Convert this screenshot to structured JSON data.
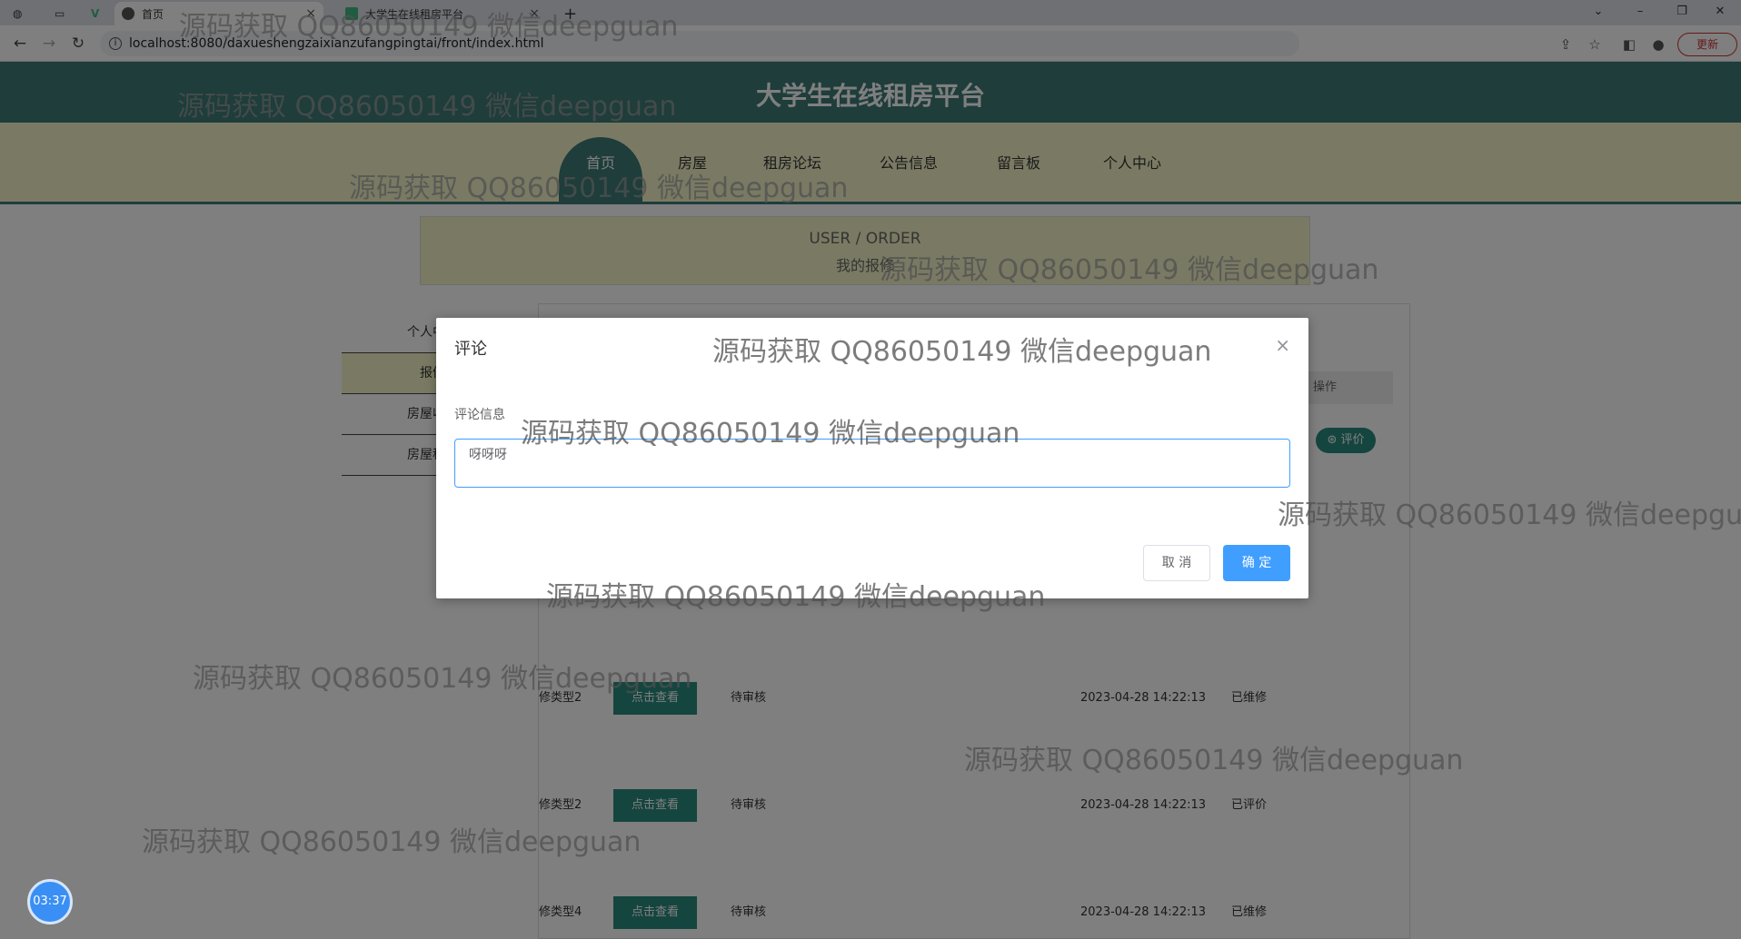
{
  "browser": {
    "tabs": [
      {
        "label": "首页",
        "active": true
      },
      {
        "label": "大学生在线租房平台",
        "active": false
      }
    ],
    "new_tab": "+",
    "url": "localhost:8080/daxueshengzaixianzufangpingtai/front/index.html",
    "update_label": "更新"
  },
  "site": {
    "title": "大学生在线租房平台",
    "nav": [
      "首页",
      "房屋",
      "租房论坛",
      "公告信息",
      "留言板",
      "个人中心"
    ]
  },
  "banner": {
    "en": "USER / ORDER",
    "cn": "我的报修"
  },
  "sidebar": [
    "个人中心",
    "报修",
    "房屋收藏",
    "房屋租赁"
  ],
  "table": {
    "ops_header": "操作",
    "eval_button": "评价",
    "rows": [
      {
        "type": "修类型2",
        "button": "点击查看",
        "status": "待审核",
        "time": "2023-04-28 14:22:13",
        "state": "已维修"
      },
      {
        "type": "修类型2",
        "button": "点击查看",
        "status": "待审核",
        "time": "2023-04-28 14:22:13",
        "state": "已评价"
      },
      {
        "type": "修类型4",
        "button": "点击查看",
        "status": "待审核",
        "time": "2023-04-28 14:22:13",
        "state": "已维修"
      }
    ]
  },
  "dialog": {
    "title": "评论",
    "close": "×",
    "field_label": "评论信息",
    "textarea_value": "呀呀呀",
    "cancel": "取 消",
    "confirm": "确 定"
  },
  "timer": "03:37",
  "watermark": "源码获取 QQ86050149 微信deepguan",
  "colors": {
    "header": "#3d7b77",
    "nav_bg": "#f4f5c9",
    "primary": "#409eff",
    "teal_button": "#2a8a7f"
  }
}
